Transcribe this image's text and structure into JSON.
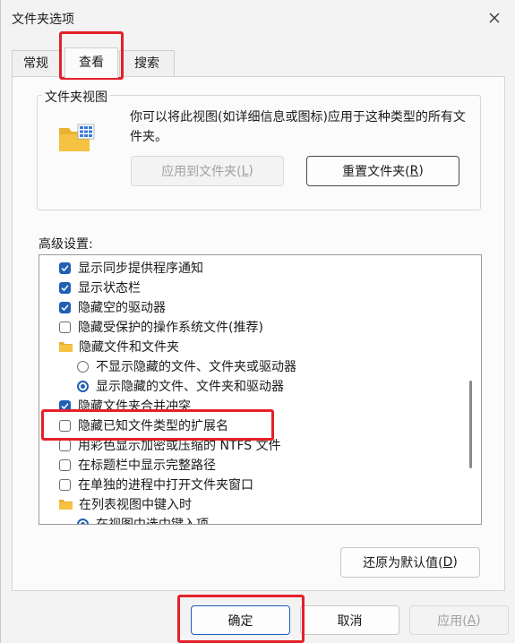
{
  "window": {
    "title": "文件夹选项"
  },
  "tabs": [
    {
      "label": "常规"
    },
    {
      "label": "查看"
    },
    {
      "label": "搜索"
    }
  ],
  "folder_view": {
    "legend": "文件夹视图",
    "description": "你可以将此视图(如详细信息或图标)应用于这种类型的所有文件夹。",
    "apply_btn_text": "应用到文件夹(",
    "apply_btn_key": "L",
    "apply_btn_tail": ")",
    "reset_btn_text": "重置文件夹(",
    "reset_btn_key": "R",
    "reset_btn_tail": ")"
  },
  "advanced": {
    "label": "高级设置:",
    "items": [
      {
        "kind": "checkbox",
        "checked": true,
        "indent": 0,
        "label": "显示同步提供程序通知"
      },
      {
        "kind": "checkbox",
        "checked": true,
        "indent": 0,
        "label": "显示状态栏"
      },
      {
        "kind": "checkbox",
        "checked": true,
        "indent": 0,
        "label": "隐藏空的驱动器"
      },
      {
        "kind": "checkbox",
        "checked": false,
        "indent": 0,
        "label": "隐藏受保护的操作系统文件(推荐)"
      },
      {
        "kind": "folder",
        "checked": false,
        "indent": 0,
        "label": "隐藏文件和文件夹"
      },
      {
        "kind": "radio",
        "checked": false,
        "indent": 1,
        "label": "不显示隐藏的文件、文件夹或驱动器"
      },
      {
        "kind": "radio",
        "checked": true,
        "indent": 1,
        "label": "显示隐藏的文件、文件夹和驱动器"
      },
      {
        "kind": "checkbox",
        "checked": true,
        "indent": 0,
        "label": "隐藏文件夹合并冲突"
      },
      {
        "kind": "checkbox",
        "checked": false,
        "indent": 0,
        "label": "隐藏已知文件类型的扩展名"
      },
      {
        "kind": "checkbox",
        "checked": false,
        "indent": 0,
        "label": "用彩色显示加密或压缩的 NTFS 文件"
      },
      {
        "kind": "checkbox",
        "checked": false,
        "indent": 0,
        "label": "在标题栏中显示完整路径"
      },
      {
        "kind": "checkbox",
        "checked": false,
        "indent": 0,
        "label": "在单独的进程中打开文件夹窗口"
      },
      {
        "kind": "folder",
        "checked": false,
        "indent": 0,
        "label": "在列表视图中键入时"
      },
      {
        "kind": "radio",
        "checked": true,
        "indent": 1,
        "label": "在视图中选中键入项"
      }
    ]
  },
  "restore_defaults": {
    "text": "还原为默认值(",
    "key": "D",
    "tail": ")"
  },
  "footer": {
    "ok": "确定",
    "cancel": "取消",
    "apply_text": "应用(",
    "apply_key": "A",
    "apply_tail": ")"
  },
  "colors": {
    "accent": "#1f5fb5",
    "highlight": "#e4202a",
    "folder": "#f5c242"
  }
}
